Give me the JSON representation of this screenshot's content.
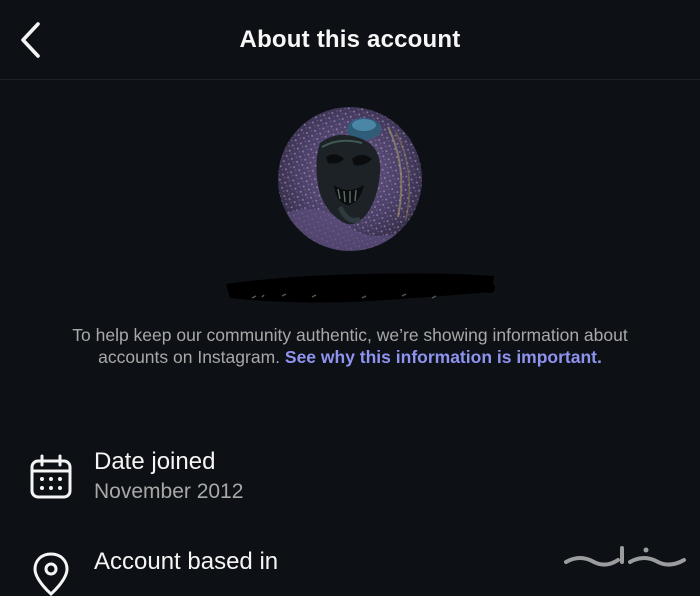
{
  "header": {
    "title": "About this account",
    "back_icon": "chevron-left-icon"
  },
  "profile": {
    "avatar_icon": "profile-photo"
  },
  "info": {
    "text": "To help keep our community authentic, we’re showing information about accounts on Instagram. ",
    "link": "See why this information is important."
  },
  "details": {
    "date_joined": {
      "icon": "calendar-icon",
      "title": "Date joined",
      "value": "November 2012"
    },
    "account_based_in": {
      "icon": "location-pin-icon",
      "title": "Account based in"
    }
  },
  "colors": {
    "background": "#0d1014",
    "link": "#8f93f0",
    "secondary_text": "#a8a8a8"
  },
  "watermark": {
    "text": "حراج"
  }
}
